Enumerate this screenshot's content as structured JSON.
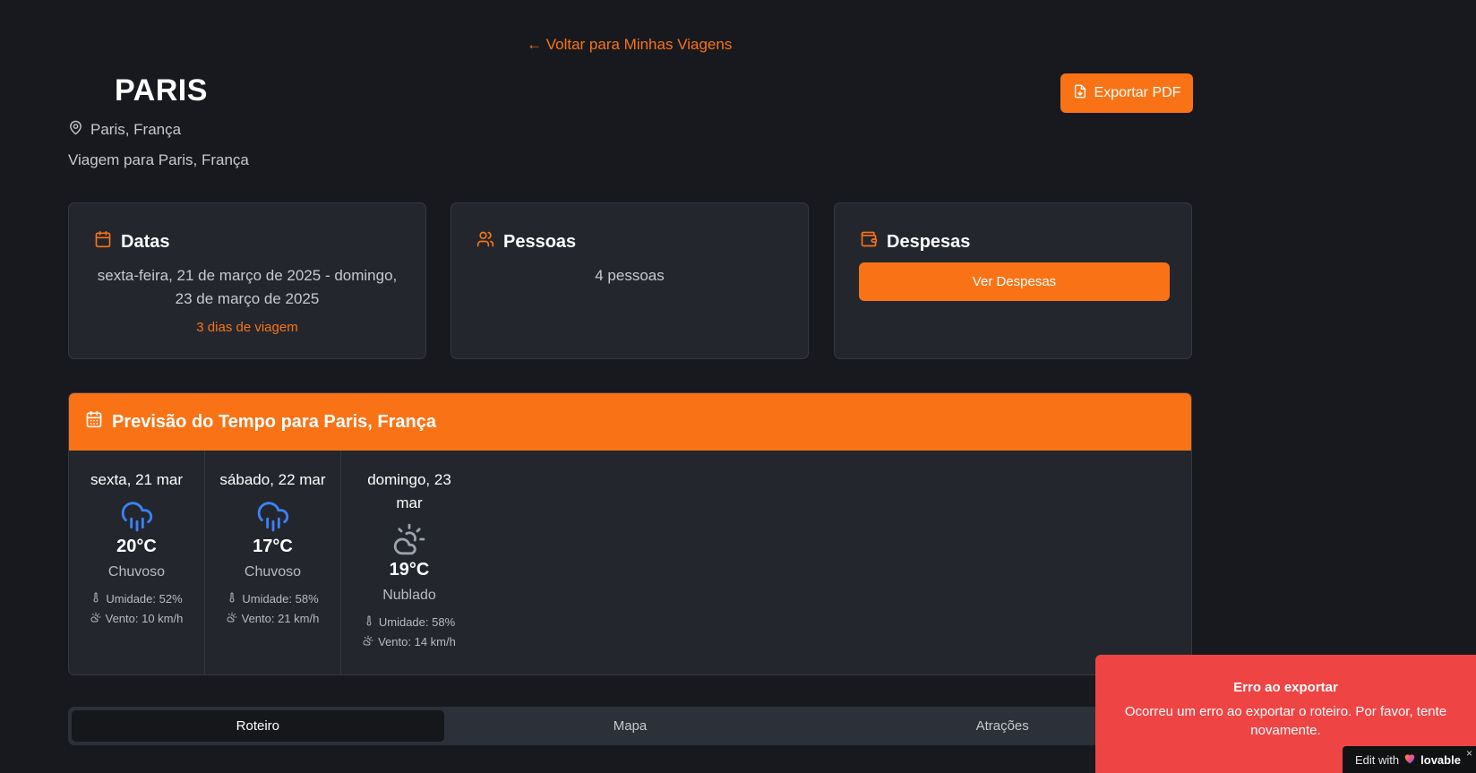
{
  "nav": {
    "back_label": "← Voltar para Minhas Viagens"
  },
  "trip": {
    "title": "PARIS",
    "location": "Paris, França",
    "description": "Viagem para Paris, França",
    "export_label": "Exportar PDF"
  },
  "cards": {
    "dates": {
      "title": "Datas",
      "range": "sexta-feira, 21 de março de 2025 - domingo, 23 de março de 2025",
      "duration": "3 dias de viagem"
    },
    "people": {
      "title": "Pessoas",
      "count": "4 pessoas"
    },
    "expenses": {
      "title": "Despesas",
      "button_label": "Ver Despesas"
    }
  },
  "weather": {
    "title": "Previsão do Tempo para Paris, França",
    "days": [
      {
        "date": "sexta, 21 mar",
        "icon": "rain-cloud-icon",
        "temp": "20°C",
        "condition": "Chuvoso",
        "humidity": "Umidade: 52%",
        "wind": "Vento: 10 km/h"
      },
      {
        "date": "sábado, 22 mar",
        "icon": "rain-cloud-icon",
        "temp": "17°C",
        "condition": "Chuvoso",
        "humidity": "Umidade: 58%",
        "wind": "Vento: 21 km/h"
      },
      {
        "date": "domingo, 23 mar",
        "icon": "partly-cloudy-icon",
        "temp": "19°C",
        "condition": "Nublado",
        "humidity": "Umidade: 58%",
        "wind": "Vento: 14 km/h"
      }
    ]
  },
  "tabs": [
    {
      "label": "Roteiro",
      "active": true
    },
    {
      "label": "Mapa",
      "active": false
    },
    {
      "label": "Atrações",
      "active": false
    }
  ],
  "toast": {
    "title": "Erro ao exportar",
    "message": "Ocorreu um erro ao exportar o roteiro. Por favor, tente novamente."
  },
  "badge": {
    "prefix": "Edit with",
    "brand": "lovable",
    "close": "×"
  },
  "colors": {
    "accent": "#f97316",
    "error": "#ef4444",
    "background": "#17191e",
    "card": "#23262d",
    "rain_icon": "#3b82f6"
  }
}
